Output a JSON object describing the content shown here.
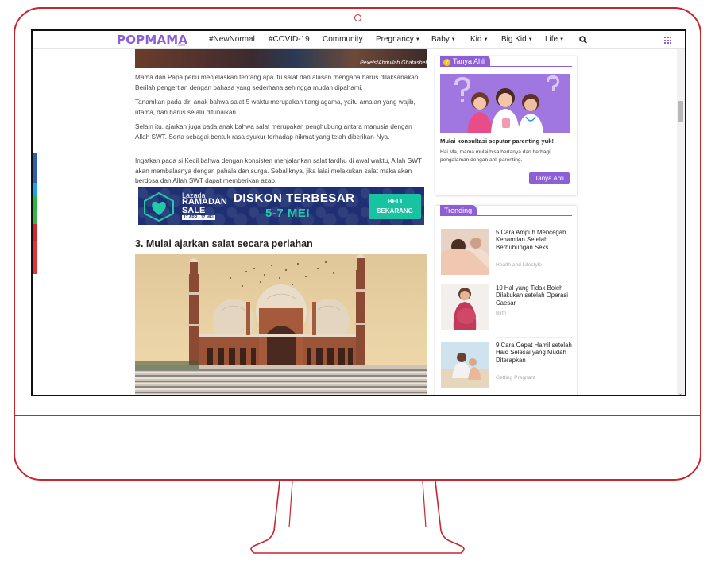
{
  "nav": {
    "logo": "POPMAMA",
    "logo_sub": ".com",
    "items": [
      {
        "label": "#NewNormal",
        "has_caret": false
      },
      {
        "label": "#COVID-19",
        "has_caret": false
      },
      {
        "label": "Community",
        "has_caret": false
      },
      {
        "label": "Pregnancy",
        "has_caret": true
      },
      {
        "label": "Baby",
        "has_caret": true
      },
      {
        "label": "Kid",
        "has_caret": true
      },
      {
        "label": "Big Kid",
        "has_caret": true
      },
      {
        "label": "Life",
        "has_caret": true
      }
    ],
    "search_icon": "search-icon",
    "menu_icon": "grid-menu-icon"
  },
  "article": {
    "image_credit": "Pexels/Abdullah Ghatasheh",
    "paragraphs": [
      "Mama dan Papa perlu menjelaskan tentang apa itu salat dan alasan mengapa harus dilaksanakan. Berilah pengertian dengan bahasa yang sederhana sehingga mudah dipahami.",
      "Tanamkan pada diri anak bahwa salat 5 waktu merupakan tiang agama, yaitu amalan yang wajib, utama, dan harus selalu ditunaikan.",
      "Selain itu, ajarkan juga pada anak bahwa salat merupakan penghubung antara manusia dengan Allah SWT. Serta sebagai bentuk rasa syukur terhadap nikmat yang telah diberikan-Nya.",
      "Ingatkan pada si Kecil bahwa dengan konsisten menjalankan salat fardhu di awal waktu, Allah SWT akan membalasnya dengan pahala dan surga. Sebaliknya, jika lalai melakukan salat maka akan berdosa dan Allah SWT dapat memberikan azab."
    ],
    "banner": {
      "brand": "Lazada",
      "campaign_line1": "RAMADAN",
      "campaign_line2": "SALE",
      "dates": "17 APR - 17 MEI",
      "headline": "DISKON TERBESAR",
      "subhead": "5-7 MEI",
      "cta_line1": "BELI",
      "cta_line2": "SEKARANG"
    },
    "section_heading": "3. Mulai ajarkan salat secara perlahan"
  },
  "sidebar": {
    "tanya_ahli": {
      "tab_label": "Tanya Ahli",
      "title": "Mulai konsultasi seputar parenting yuk!",
      "description": "Hai Ma, mama mulai bisa bertanya dan berbagi pengalaman dengan ahli parenting.",
      "button_label": "Tanya Ahli"
    },
    "trending": {
      "tab_label": "Trending",
      "items": [
        {
          "title": "5 Cara Ampuh Mencegah Kehamilan Setelah Berhubungan Seks",
          "category": "Health and Lifestyle"
        },
        {
          "title": "10 Hal yang Tidak Boleh Dilakukan setelah Operasi Caesar",
          "category": "Birth"
        },
        {
          "title": "9 Cara Cepat Hamil setelah Haid Selesai yang Mudah Diterapkan",
          "category": "Getting Pregnant"
        }
      ]
    }
  },
  "colors": {
    "brand_purple": "#8c5fd6",
    "monitor_red": "#c9252f",
    "banner_navy": "#1e2f73",
    "banner_teal": "#17c3a0"
  }
}
